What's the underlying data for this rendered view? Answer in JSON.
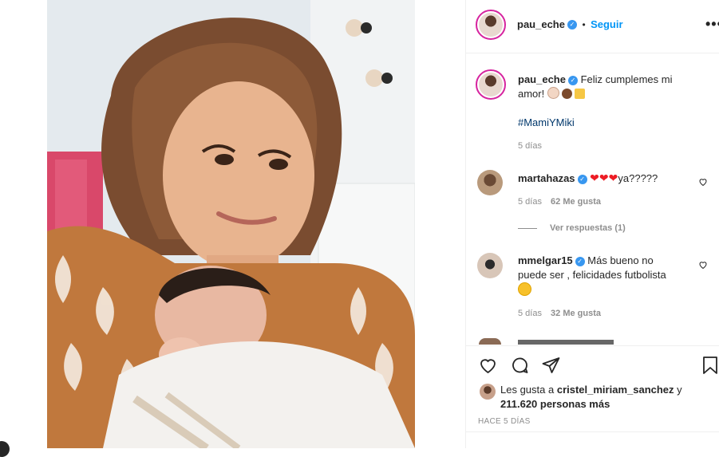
{
  "header": {
    "username": "pau_eche",
    "separator": "•",
    "follow_label": "Seguir",
    "more_glyph": "•••"
  },
  "caption": {
    "username": "pau_eche",
    "text": "Feliz cumplemes mi amor!",
    "hashtag": "#MamiYMiki",
    "time": "5 días"
  },
  "comments": [
    {
      "username": "martahazas",
      "text": "ya?????",
      "time": "5 días",
      "likes": "62 Me gusta",
      "replies": "Ver respuestas (1)"
    },
    {
      "username": "mmelgar15",
      "text_line1": "Más bueno no",
      "text_line2": "puede ser , felicidades futbolista",
      "time": "5 días",
      "likes": "32 Me gusta"
    }
  ],
  "likes": {
    "prefix": "Les gusta a",
    "user": "cristel_miriam_sanchez",
    "conj": "y",
    "count": "211.620 personas más"
  },
  "posted": "HACE 5 DÍAS",
  "colors": {
    "accent": "#0095f6",
    "verified": "#3897f0",
    "heart": "#ed1c24"
  }
}
